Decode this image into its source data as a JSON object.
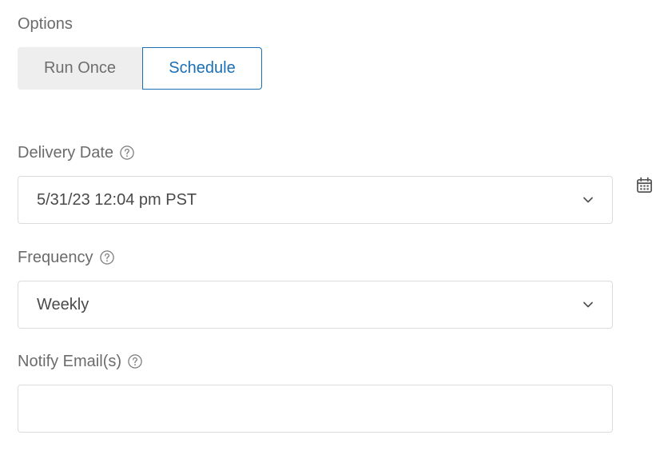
{
  "options": {
    "label": "Options",
    "run_once_label": "Run Once",
    "schedule_label": "Schedule",
    "selected": "Schedule"
  },
  "delivery_date": {
    "label": "Delivery Date",
    "value": "5/31/23 12:04 pm PST"
  },
  "frequency": {
    "label": "Frequency",
    "value": "Weekly"
  },
  "notify_emails": {
    "label": "Notify Email(s)",
    "value": "",
    "placeholder": ""
  },
  "icons": {
    "help": "help-icon",
    "chevron": "chevron-down-icon",
    "calendar": "calendar-icon"
  },
  "colors": {
    "accent": "#1a6fb5",
    "label_text": "#6b6b6b",
    "border": "#dcdcdc",
    "segment_inactive_bg": "#eeeeee"
  }
}
